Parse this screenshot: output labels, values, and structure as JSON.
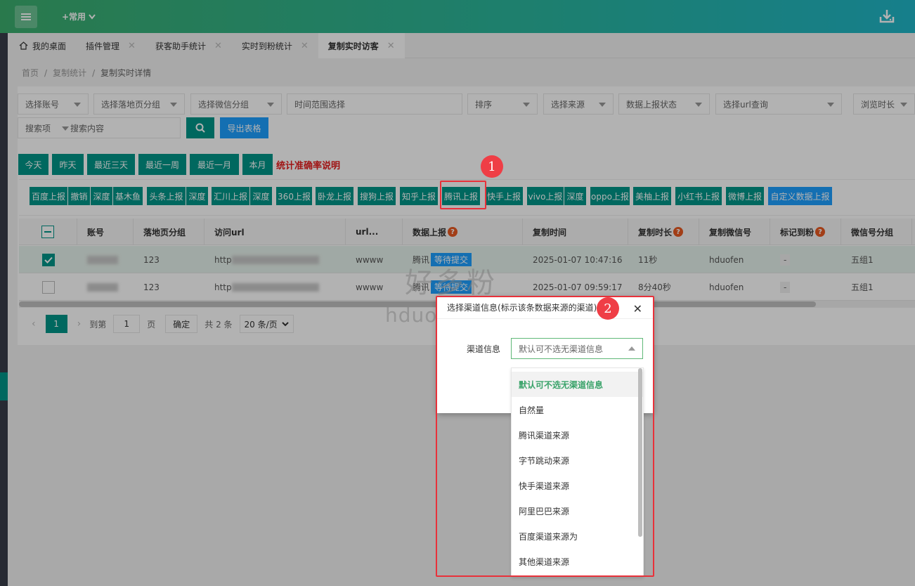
{
  "header": {
    "common_label": "+常用"
  },
  "tabs": [
    {
      "label": "我的桌面",
      "closable": false
    },
    {
      "label": "插件管理",
      "closable": true
    },
    {
      "label": "获客助手统计",
      "closable": true
    },
    {
      "label": "实时到粉统计",
      "closable": true
    },
    {
      "label": "复制实时访客",
      "closable": true,
      "active": true
    }
  ],
  "breadcrumb": [
    "首页",
    "复制统计",
    "复制实时详情"
  ],
  "filters": {
    "account": "选择账号",
    "landing_group": "选择落地页分组",
    "wechat_group": "选择微信分组",
    "time_range": "时间范围选择",
    "sort": "排序",
    "source": "选择来源",
    "report_status": "数据上报状态",
    "url_query": "选择url查询",
    "browse_time": "浏览时长",
    "search_item": "搜索项",
    "search_content": "搜索内容",
    "export": "导出表格"
  },
  "quick_dates": [
    "今天",
    "昨天",
    "最近三天",
    "最近一周",
    "最近一月",
    "本月"
  ],
  "accuracy_note": "统计准确率说明",
  "report_buttons": [
    "百度上报",
    "撤销",
    "深度",
    "基木鱼",
    "头条上报",
    "深度",
    "汇川上报",
    "深度",
    "360上报",
    "卧龙上报",
    "搜狗上报",
    "知乎上报",
    "腾讯上报",
    "快手上报",
    "vivo上报",
    "深度",
    "oppo上报",
    "美柚上报",
    "小红书上报",
    "微博上报",
    "自定义数据上报"
  ],
  "table": {
    "columns": [
      "账号",
      "落地页分组",
      "访问url",
      "url...",
      "数据上报",
      "复制时间",
      "复制时长",
      "复制微信号",
      "标记到粉",
      "微信号分组"
    ],
    "rows": [
      {
        "group": "123",
        "url": "http",
        "urlname": "wwww",
        "report": "腾讯",
        "status": "等待提交",
        "time": "2025-01-07 10:47:16",
        "duration": "11秒",
        "wechat": "hduofen",
        "mark": "-",
        "wgroup": "五组1",
        "checked": true
      },
      {
        "group": "123",
        "url": "http",
        "urlname": "wwww",
        "report": "腾讯",
        "status": "等待提交",
        "time": "2025-01-07 09:59:17",
        "duration": "8分40秒",
        "wechat": "hduofen",
        "mark": "-",
        "wgroup": "五组1",
        "checked": false
      }
    ]
  },
  "pager": {
    "page": "1",
    "goto": "到第",
    "page_input": "1",
    "page_unit": "页",
    "confirm": "确定",
    "total": "共 2 条",
    "per_page": "20 条/页"
  },
  "modal": {
    "title": "选择渠道信息(标示该条数据来源的渠道)",
    "field_label": "渠道信息",
    "selected": "默认可不选无渠道信息",
    "options": [
      "默认可不选无渠道信息",
      "自然量",
      "腾讯渠道来源",
      "字节跳动来源",
      "快手渠道来源",
      "阿里巴巴来源",
      "百度渠道来源为",
      "其他渠道来源"
    ]
  },
  "steps": [
    "1",
    "2"
  ],
  "watermark": {
    "cn": "好多粉",
    "en": "hduofen.com"
  },
  "colors": {
    "primary": "#009688",
    "blue": "#1e9fff",
    "highlight": "#e8313a"
  }
}
